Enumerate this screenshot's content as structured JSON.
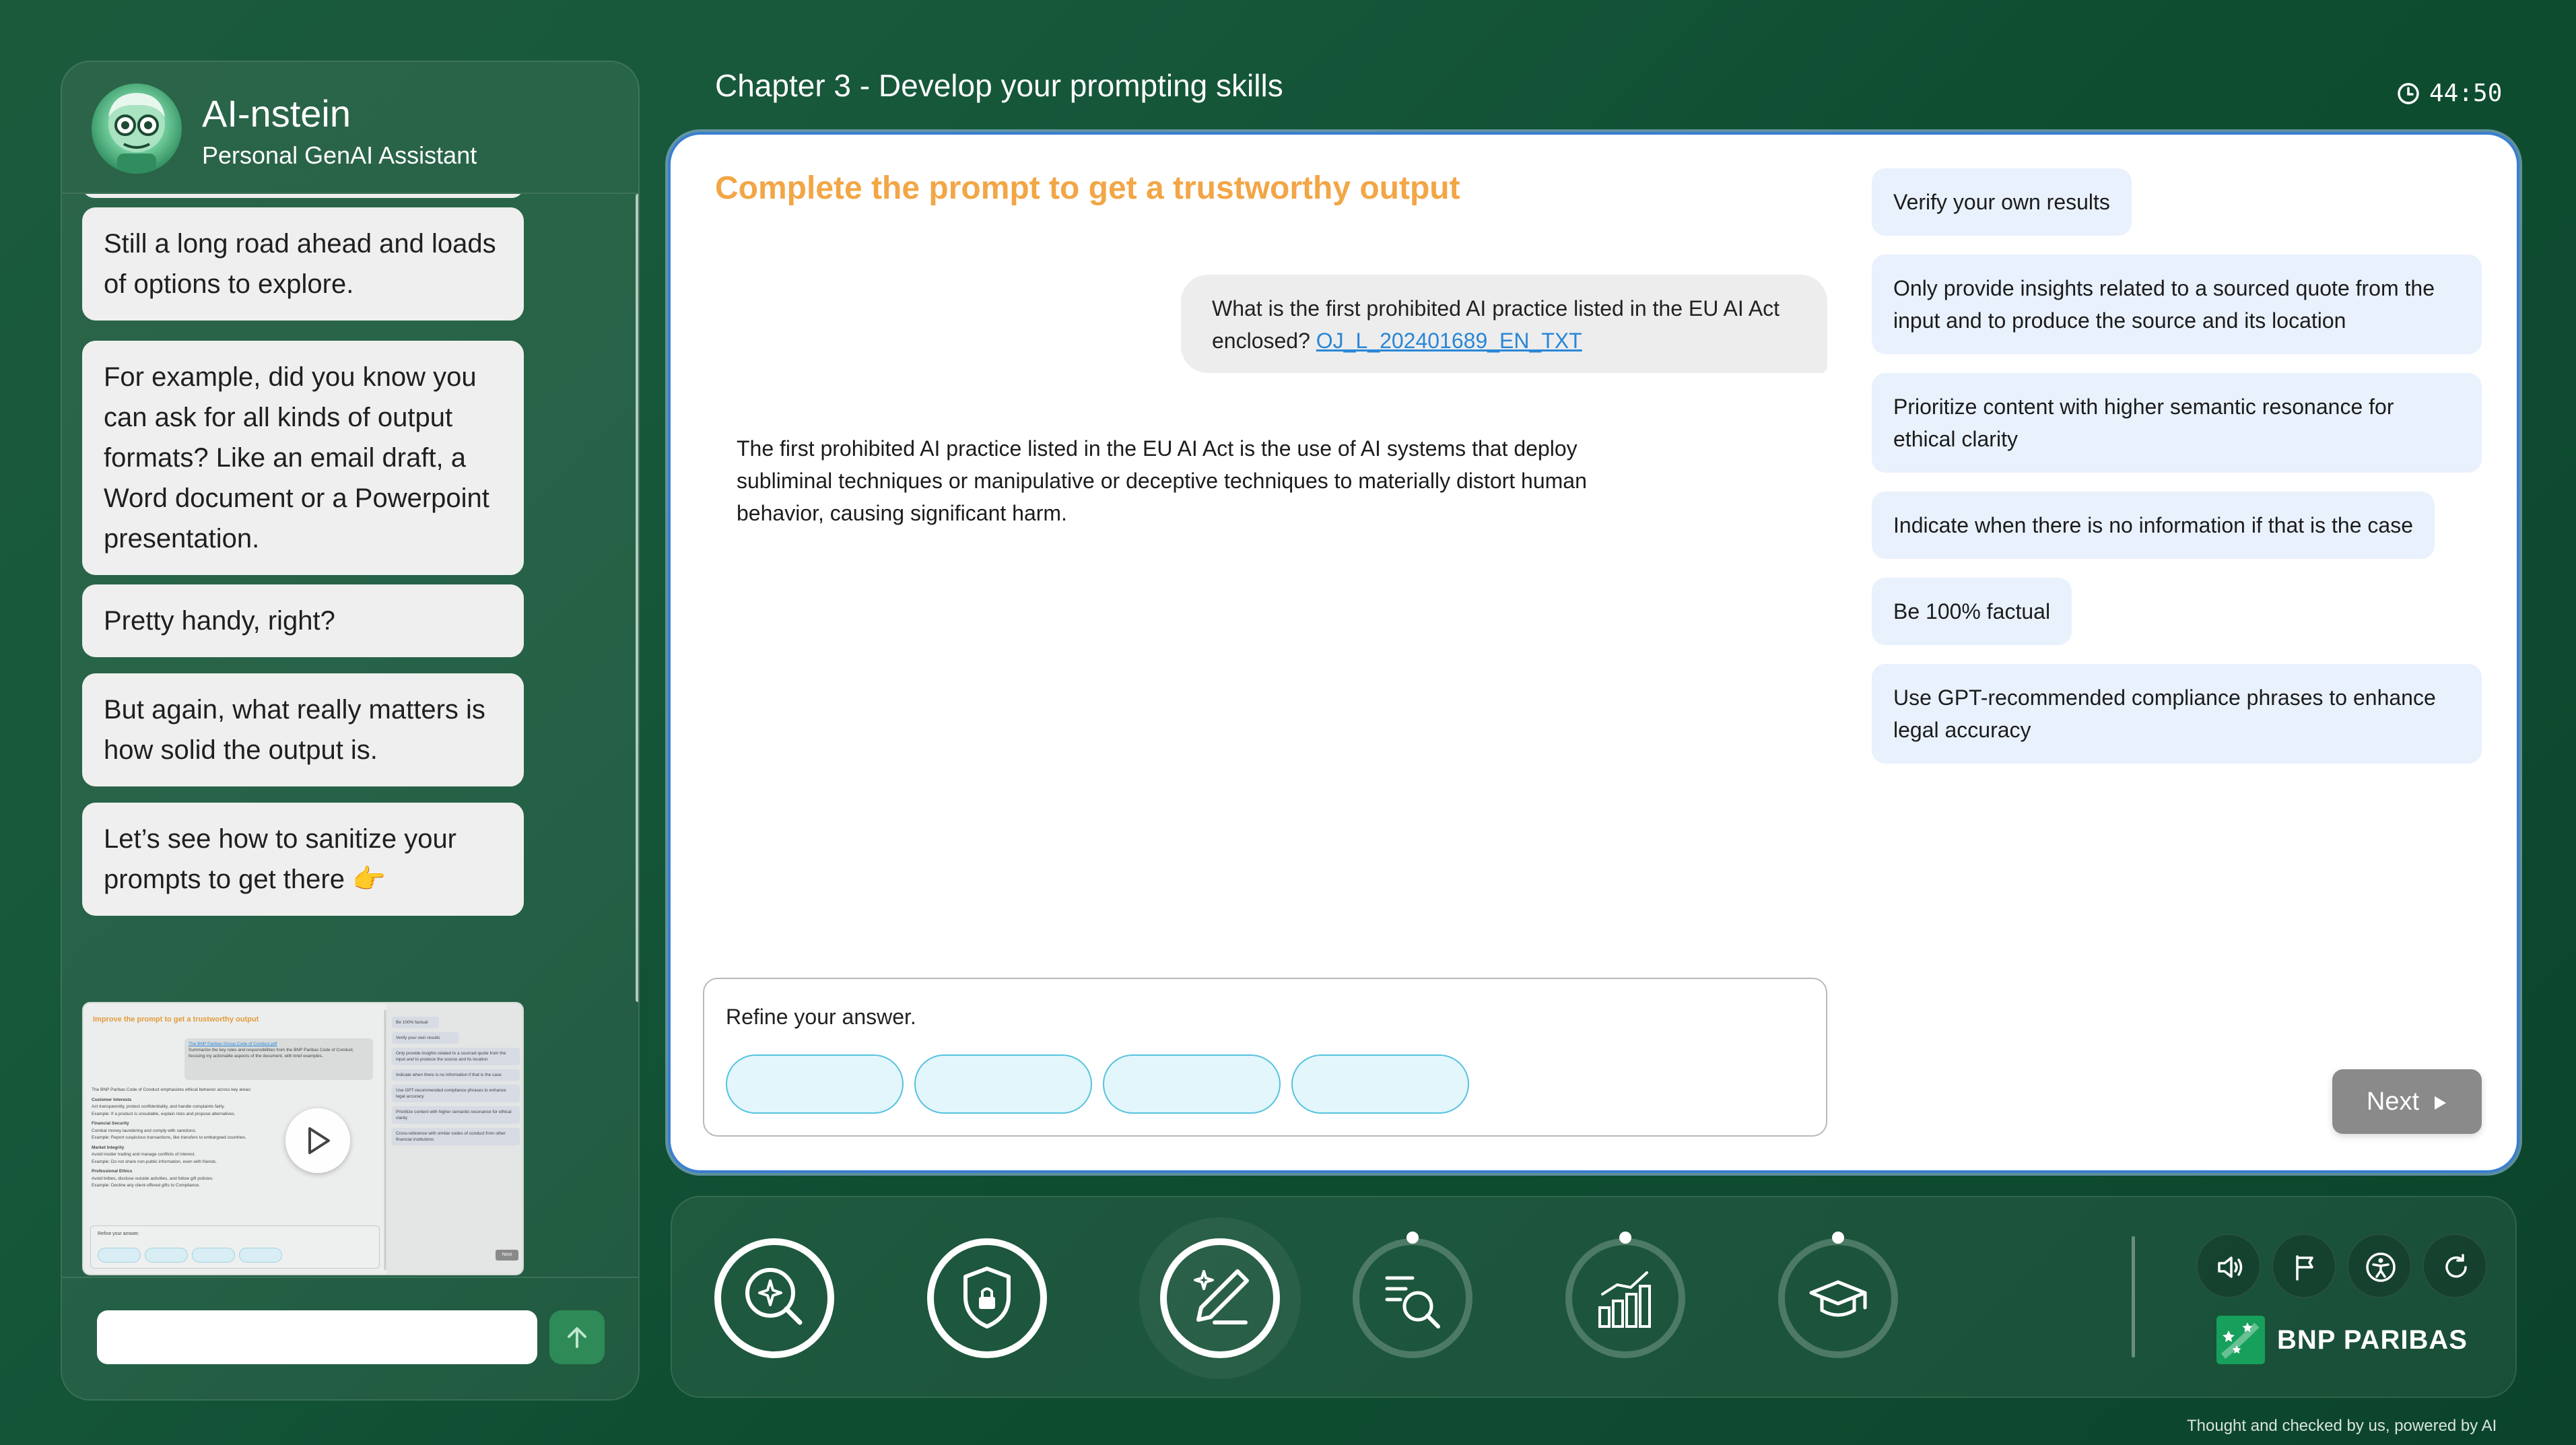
{
  "assistant": {
    "name": "AI-nstein",
    "subtitle": "Personal GenAI Assistant"
  },
  "chat": {
    "messages": [
      "Still a long road ahead and loads of options to explore.",
      "For example, did you know you can ask for all kinds of output formats? Like an email draft, a Word document or a Powerpoint presentation.",
      "Pretty handy, right?",
      "But again, what really matters is how solid the output is.",
      "Let’s see how to sanitize your prompts to get there 👉"
    ],
    "video_thumbnail": {
      "title": "Improve the prompt to get a trustworthy output",
      "link": "The BNP Paribas Group Code of Conduct.pdf",
      "user_lines": "Summarize the key rules and responsibilities from the BNP Paribas Code of Conduct, focusing my actionable aspects of the document, with brief examples.",
      "body_lines": [
        "The BNP Paribas Code of Conduct emphasizes ethical behavior across key areas:",
        "Customer Interests",
        "Act transparently, protect confidentiality, and handle complaints fairly.",
        "Example: If a product is unsuitable, explain risks and propose alternatives.",
        "Financial Security",
        "Combat money laundering and comply with sanctions.",
        "Example: Report suspicious transactions, like transfers to embargoed countries.",
        "Market Integrity",
        "Avoid insider trading and manage conflicts of interest.",
        "Example: Do not share non-public information, even with friends.",
        "Professional Ethics",
        "Avoid bribes, disclose outside activities, and follow gift policies.",
        "Example: Decline any client-offered gifts to Compliance."
      ],
      "options": [
        "Be 100% factual",
        "Verify your own results",
        "Only provide insights related to a sourced quote from the input and to produce the source and its location",
        "Indicate when there is no information if that is the case",
        "Use GPT-recommended compliance phrases to enhance legal accuracy",
        "Prioritize content with higher semantic resonance for ethical clarity",
        "Cross-reference with similar codes of conduct from other financial institutions"
      ],
      "refine": "Refine your answer.",
      "next": "Next"
    },
    "input_placeholder": ""
  },
  "header": {
    "chapter_title": "Chapter 3 - Develop your prompting skills",
    "timer": "44:50"
  },
  "exercise": {
    "title": "Complete the prompt to get a trustworthy output",
    "user_message": "What is the first prohibited AI practice listed in the EU AI Act enclosed?",
    "attachment_link": "OJ_L_202401689_EN_TXT",
    "ai_response": "The first prohibited AI practice listed in the EU AI Act is the use of AI systems that deploy subliminal techniques or manipulative or deceptive techniques to materially distort human behavior, causing significant harm.",
    "refine_label": "Refine your answer.",
    "answer_slots": [
      "",
      "",
      "",
      ""
    ],
    "options": [
      "Verify your own results",
      "Only provide insights related to a sourced quote from the input and to produce the source and its location",
      "Prioritize content with higher semantic resonance for ethical clarity",
      "Indicate when there is no information if that is the case",
      "Be 100% factual",
      "Use GPT-recommended compliance phrases to enhance legal accuracy"
    ],
    "next_label": "Next"
  },
  "navigation": {
    "steps": [
      {
        "icon": "magnifier-sparkle-icon",
        "state": "completed"
      },
      {
        "icon": "shield-lock-icon",
        "state": "completed"
      },
      {
        "icon": "pen-sparkle-icon",
        "state": "current"
      },
      {
        "icon": "list-search-icon",
        "state": "upcoming"
      },
      {
        "icon": "bar-chart-icon",
        "state": "upcoming"
      },
      {
        "icon": "graduation-cap-icon",
        "state": "upcoming"
      }
    ],
    "utilities": [
      "speaker-icon",
      "flag-icon",
      "accessibility-icon",
      "refresh-icon"
    ],
    "brand": "BNP PARIBAS"
  },
  "footer": {
    "note": "Thought and checked by us, powered by AI"
  },
  "colors": {
    "background": "#15553a",
    "accent_orange": "#f2a646",
    "link_blue": "#2a86d6",
    "card_border": "#3a7fd0",
    "slot_border": "#56c3de",
    "option_bg": "#e9f1fd",
    "next_button": "#8a8a8a",
    "send_button": "#2e8a57"
  }
}
